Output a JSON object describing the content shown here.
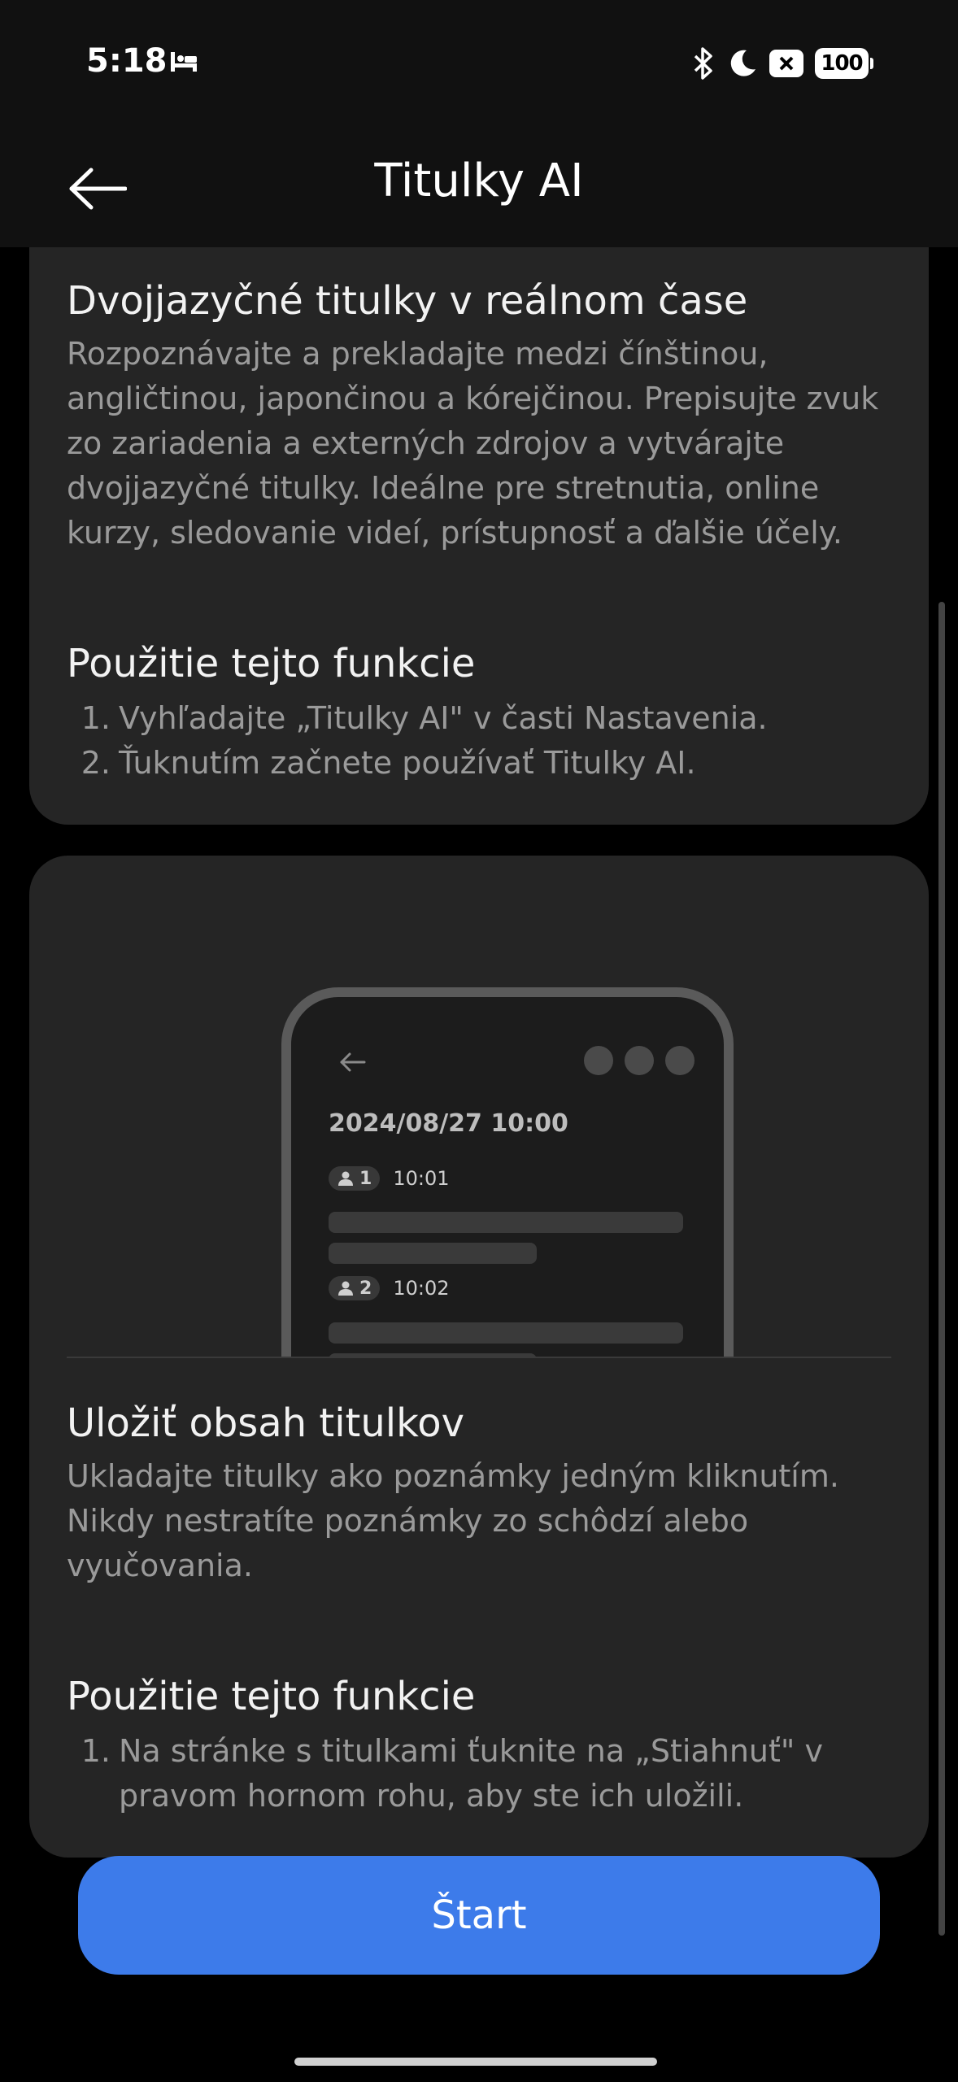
{
  "status_bar": {
    "time": "5:18",
    "battery": "100",
    "icons": [
      "sleep-icon",
      "bluetooth-icon",
      "moon-icon",
      "close-box-icon",
      "battery-icon"
    ]
  },
  "app_bar": {
    "title": "Titulky AI",
    "back_icon": "arrow-left-icon"
  },
  "feature_1": {
    "title": "Dvojjazyčné titulky v reálnom čase",
    "description": "Rozpoznávajte a prekladajte medzi čínštinou, angličtinou, japončinou a kórejčinou. Prepisujte zvuk zo zariadenia a externých zdrojov a vytvárajte dvojjazyčné titulky. Ideálne pre stretnutia, online kurzy, sledovanie videí, prístupnosť a ďalšie účely.",
    "usage_title": "Použitie tejto funkcie",
    "steps": [
      {
        "num": "1.",
        "text": "Vyhľadajte „Titulky AI\" v časti Nastavenia."
      },
      {
        "num": "2.",
        "text": "Ťuknutím začnete používať Titulky AI."
      }
    ]
  },
  "illustration": {
    "date": "2024/08/27 10:00",
    "entries": [
      {
        "speaker": "1",
        "time": "10:01"
      },
      {
        "speaker": "2",
        "time": "10:02"
      }
    ]
  },
  "feature_2": {
    "title": "Uložiť obsah titulkov",
    "description": "Ukladajte titulky ako poznámky jedným kliknutím. Nikdy nestratíte poznámky zo schôdzí alebo vyučovania.",
    "usage_title": "Použitie tejto funkcie",
    "steps": [
      {
        "num": "1.",
        "text": "Na stránke s titulkami ťuknite na „Stiahnuť\" v pravom hornom rohu, aby ste ich uložili."
      }
    ]
  },
  "start_button": {
    "label": "Štart",
    "color": "#3d7bea"
  }
}
